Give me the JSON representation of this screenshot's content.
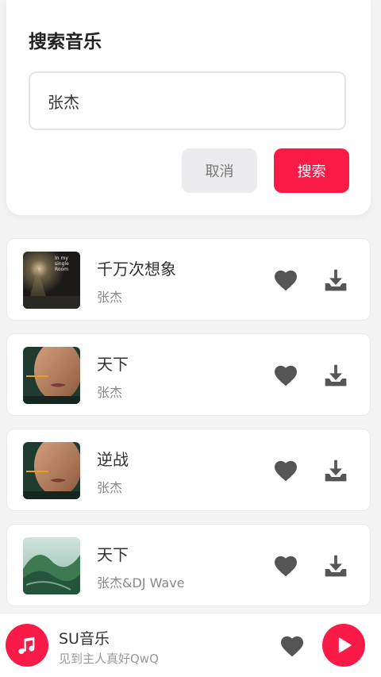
{
  "search": {
    "title": "搜索音乐",
    "query": "张杰",
    "cancel_label": "取消",
    "submit_label": "搜索"
  },
  "results": [
    {
      "title": "千万次想象",
      "artist": "张杰",
      "cover": "dark-night-cover",
      "cover_text": "In my single Room"
    },
    {
      "title": "天下",
      "artist": "张杰",
      "cover": "portrait-cover"
    },
    {
      "title": "逆战",
      "artist": "张杰",
      "cover": "portrait-cover"
    },
    {
      "title": "天下",
      "artist": "张杰&DJ Wave",
      "cover": "green-landscape-cover"
    }
  ],
  "player": {
    "title": "SU音乐",
    "subtitle": "见到主人真好QwQ"
  },
  "icons": {
    "heart": "heart-icon",
    "download": "download-icon",
    "music_note": "music-note-icon",
    "play": "play-icon"
  },
  "colors": {
    "accent": "#fa1a48",
    "icon_gray": "#555555",
    "background": "#f3f3f4"
  }
}
